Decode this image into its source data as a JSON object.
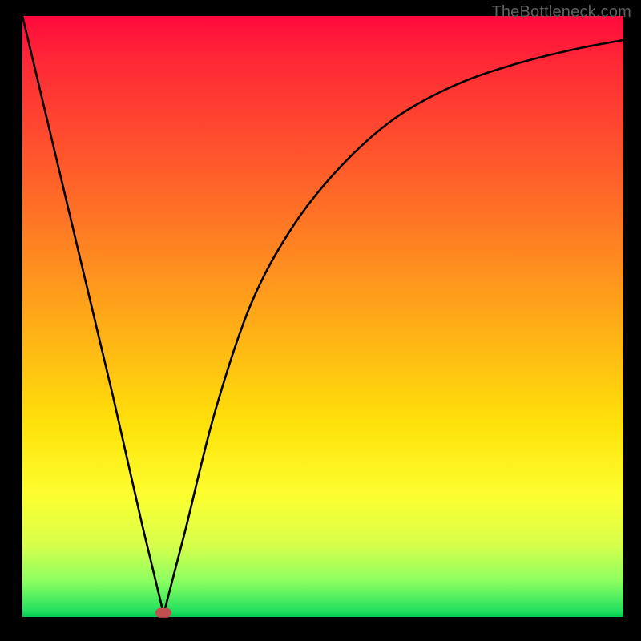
{
  "watermark": "TheBottleneck.com",
  "chart_data": {
    "type": "line",
    "title": "",
    "xlabel": "",
    "ylabel": "",
    "xlim": [
      0,
      100
    ],
    "ylim": [
      0,
      100
    ],
    "grid": false,
    "series": [
      {
        "name": "curve",
        "x": [
          0,
          5,
          10,
          15,
          20,
          23.5,
          27,
          32,
          38,
          45,
          53,
          62,
          72,
          82,
          92,
          100
        ],
        "values": [
          100,
          79,
          58,
          37,
          15,
          0.5,
          14,
          34,
          52,
          65,
          75,
          83,
          88.5,
          92,
          94.5,
          96
        ]
      }
    ],
    "marker": {
      "x": 23.5,
      "y": 0.5,
      "color": "#c05050"
    },
    "background_gradient": {
      "top": "#ff0a3c",
      "mid1": "#ff8f1f",
      "mid2": "#ffe20a",
      "bottom": "#00c94e"
    }
  }
}
